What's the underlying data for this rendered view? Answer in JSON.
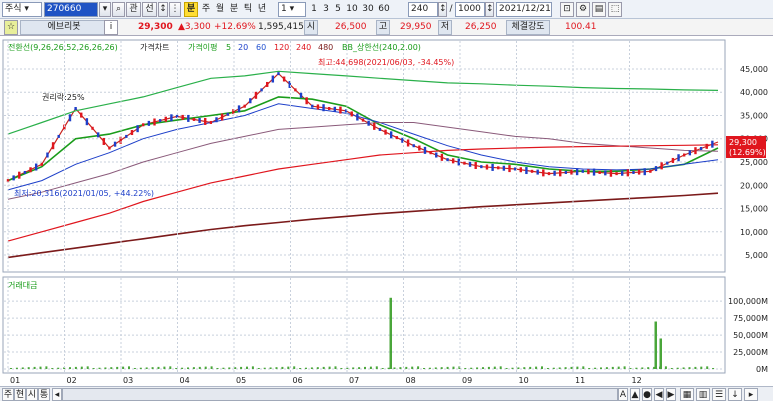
{
  "toolbar": {
    "market_select": "주식",
    "code": "270660",
    "search_icon": "magnifier-icon",
    "btn_gwan": "관",
    "btn_seon": "선",
    "btn_min": "분",
    "periods": [
      "주",
      "월",
      "분",
      "틱",
      "년"
    ],
    "interval_value": "1",
    "presets": [
      "1",
      "3",
      "5",
      "10",
      "30",
      "60"
    ],
    "count_value": "240",
    "total_count": "1000",
    "date_value": "2021/12/21"
  },
  "quote": {
    "name": "에브리봇",
    "price": "29,300",
    "change": "▲3,300",
    "change_pct": "+12.69%",
    "volume": "1,595,415",
    "open_label": "시",
    "open": "26,500",
    "high_label": "고",
    "high": "29,950",
    "low_label": "저",
    "low": "26,250",
    "strength_label": "체결강도",
    "strength": "100.41"
  },
  "legend": {
    "ichimoku": "전환선(9,26,26,52,26,26,26)",
    "price_chart": "가격차트",
    "ma_label": "가격이평",
    "ma_periods": [
      "5",
      "20",
      "60",
      "120",
      "240",
      "480"
    ],
    "ma_colors": [
      "#1a9c1a",
      "#1d3fc9",
      "#2050d0",
      "#e0161e",
      "#e0161e",
      "#7b1a1a"
    ],
    "envelope": "BB_상한선(240,2.00)"
  },
  "annotations": {
    "high": "최고:44,698(2021/06/03, -34.45%)",
    "low": "최저:20,316(2021/01/05, +44.22%)",
    "rights": "권리락:25%",
    "last_price": "29,300",
    "last_pct": "(12.69%)"
  },
  "volume_legend": "거래대금",
  "chart_data": {
    "type": "line",
    "x": [
      "01",
      "02",
      "03",
      "04",
      "05",
      "06",
      "07",
      "08",
      "09",
      "10",
      "11",
      "12"
    ],
    "price_axis": [
      "45,000",
      "40,000",
      "35,000",
      "30,000",
      "25,000",
      "20,000",
      "15,000",
      "10,000",
      "5,000"
    ],
    "volume_axis": [
      "100,000M",
      "75,000M",
      "50,000M",
      "25,000M",
      "0M"
    ],
    "ylim": [
      2000,
      48000
    ],
    "vol_ylim": [
      0,
      115000
    ],
    "series": [
      {
        "values": [
          21000,
          24500,
          36500,
          28000,
          33000,
          34800,
          33500,
          37000,
          44000,
          37000,
          36000,
          32000,
          28500,
          25500,
          24000,
          23500,
          22500,
          23000,
          22500,
          23000,
          26500,
          29300
        ]
      },
      {
        "name": "전환선",
        "values": [
          21000,
          24000,
          30000,
          31000,
          33000,
          34000,
          35000,
          36000,
          39000,
          38500,
          37000,
          33000,
          30000,
          26500,
          25000,
          24500,
          23500,
          23000,
          23000,
          23500,
          24500,
          28000
        ]
      },
      {
        "values": [
          19000,
          21000,
          24500,
          27000,
          30000,
          32000,
          33500,
          35000,
          37500,
          36500,
          35500,
          33500,
          31000,
          28500,
          26500,
          25000,
          24000,
          23500,
          23300,
          23500,
          24500,
          25500
        ]
      },
      {
        "name": "BB_상한선",
        "values": [
          31000,
          33500,
          36000,
          37500,
          39000,
          41000,
          43000,
          43500,
          44500,
          44000,
          43500,
          43000,
          42500,
          42000,
          41800,
          41500,
          41300,
          41000,
          40800,
          40700,
          40500,
          40400
        ]
      },
      {
        "values": [
          17000,
          18500,
          20500,
          22500,
          25000,
          27000,
          29000,
          30500,
          32000,
          32500,
          33000,
          33500,
          33500,
          32500,
          31500,
          30500,
          30000,
          29000,
          28500,
          28000,
          27500,
          27300
        ]
      },
      {
        "values": [
          8000,
          10000,
          12000,
          14000,
          16500,
          18500,
          20500,
          22000,
          23500,
          24500,
          25500,
          26500,
          27000,
          27500,
          27800,
          28000,
          28200,
          28300,
          28400,
          28500,
          28600,
          28700
        ]
      },
      {
        "values": [
          4500,
          5500,
          6500,
          7500,
          8500,
          9500,
          10500,
          11300,
          12000,
          12700,
          13300,
          13900,
          14400,
          14900,
          15400,
          15800,
          16200,
          16600,
          17000,
          17400,
          17800,
          18300
        ]
      }
    ],
    "volume_spikes": [
      {
        "x": "08",
        "value": 105000
      },
      {
        "x": "12",
        "value": 70000
      },
      {
        "x": "12",
        "value": 45000
      }
    ],
    "grid": true
  },
  "statusbar": {
    "tabs": [
      "주",
      "현",
      "시",
      "통"
    ],
    "zoom_controls": [
      "A",
      "▲",
      "●",
      "◀",
      "▶"
    ]
  }
}
